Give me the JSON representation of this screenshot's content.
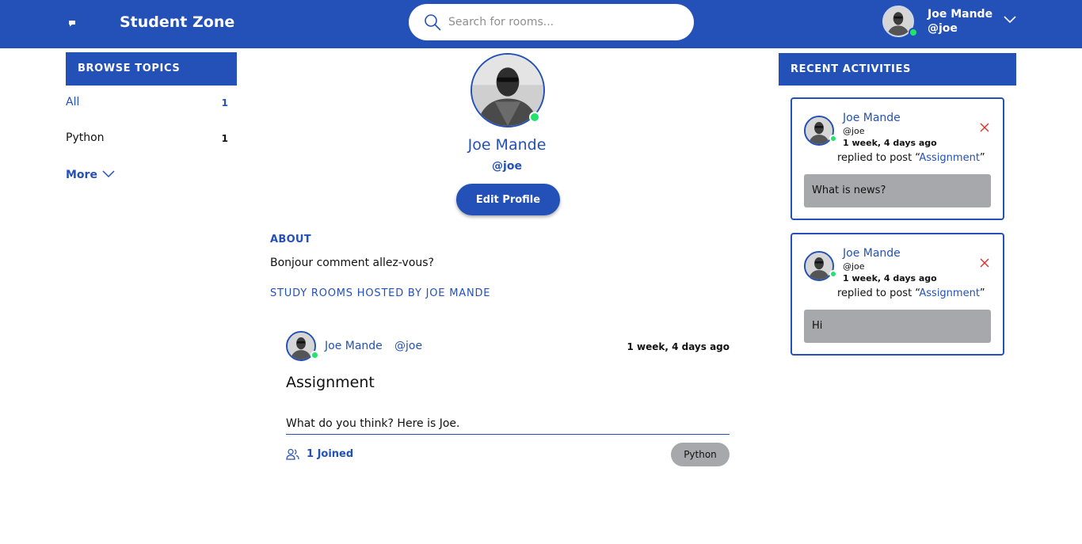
{
  "header": {
    "app_title": "Student Zone",
    "logo_icon": "chat-bubble-icon",
    "search": {
      "placeholder": "Search for rooms...",
      "value": "",
      "icon": "search-icon"
    },
    "user": {
      "name": "Joe Mande",
      "handle": "@joe",
      "status": "online",
      "menu_icon": "chevron-down-icon"
    }
  },
  "sidebar": {
    "title": "BROWSE TOPICS",
    "topics": [
      {
        "label": "All",
        "count": "1"
      },
      {
        "label": "Python",
        "count": "1"
      }
    ],
    "more_label": "More"
  },
  "profile": {
    "name": "Joe Mande",
    "handle": "@joe",
    "edit_label": "Edit Profile",
    "about_title": "ABOUT",
    "about_text": "Bonjour comment allez-vous?",
    "rooms_title": "STUDY ROOMS HOSTED BY JOE MANDE"
  },
  "rooms": [
    {
      "host": "Joe Mande",
      "handle": "@joe",
      "time": "1 week, 4 days ago",
      "title": "Assignment",
      "description": "What do you think? Here is Joe.",
      "joined": "1 Joined",
      "topic": "Python"
    }
  ],
  "activities": {
    "title": "RECENT ACTIVITIES",
    "items": [
      {
        "name": "Joe Mande",
        "handle": "@joe",
        "time": "1 week, 4 days ago",
        "action": "replied to post “",
        "post": "Assignment",
        "action_end": "”",
        "message": "What is news?"
      },
      {
        "name": "Joe Mande",
        "handle": "@joe",
        "time": "1 week, 4 days ago",
        "action": "replied to post “",
        "post": "Assignment",
        "action_end": "”",
        "message": "Hi"
      }
    ]
  },
  "colors": {
    "brand": "#2451b7",
    "online": "#22e36e",
    "tag_bg": "#a6a8ac",
    "close": "#d93025"
  }
}
